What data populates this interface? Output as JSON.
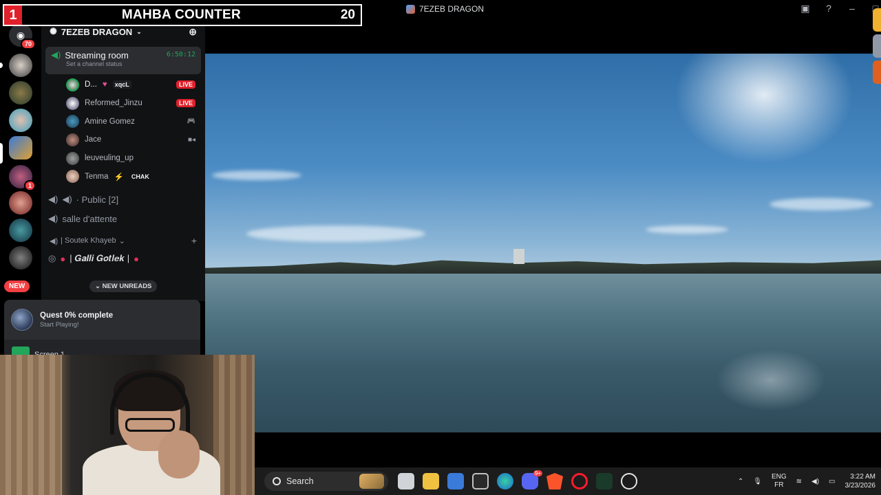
{
  "counter": {
    "left_number": "1",
    "title": "MAHBA COUNTER",
    "right_number": "20"
  },
  "window": {
    "title": "7EZEB DRAGON"
  },
  "rail": {
    "dm_badge": "70",
    "server_badge": "1",
    "new_label": "NEW"
  },
  "guild": {
    "name": "7EZEB DRAGON"
  },
  "streaming": {
    "channel": "Streaming room",
    "timer": "6:50:12",
    "status": "Set a channel status"
  },
  "voice_users": [
    {
      "name": "D...",
      "tag": "xqcL",
      "live": "LIVE"
    },
    {
      "name": "Reformed_Jinzu",
      "live": "LIVE"
    },
    {
      "name": "Amine Gomez"
    },
    {
      "name": "Jace"
    },
    {
      "name": "leuveuling_up"
    },
    {
      "name": "Tenma",
      "tag": "CHAK"
    }
  ],
  "channels": {
    "public": "· Public [2]",
    "salle": "salle d'attente",
    "category": "| Soutek Khayeb",
    "galli": "| 𝑮𝒂𝒍𝒍𝒊 𝑮𝒐𝒕𝒍𝒆𝒌 |"
  },
  "new_unreads": "NEW UNREADS",
  "quest": {
    "title": "Quest 0% complete",
    "subtitle": "Start Playing!"
  },
  "screen_share": {
    "label": "Screen 1"
  },
  "taskbar": {
    "search_placeholder": "Search",
    "lang_top": "ENG",
    "lang_bottom": "FR",
    "time": "3:22 AM",
    "date": "3/23/2026",
    "discord_badge": "9+"
  }
}
